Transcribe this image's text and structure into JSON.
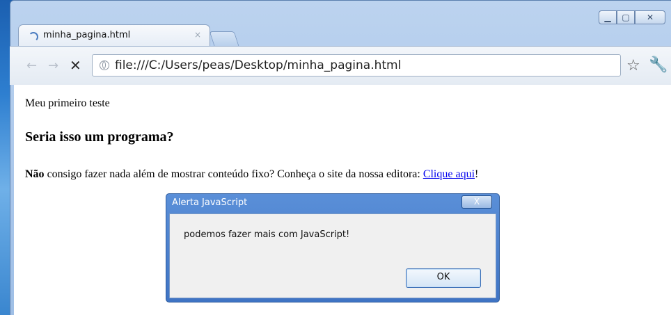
{
  "browser": {
    "tab_title": "minha_pagina.html",
    "tab_close": "×",
    "url": "file:///C:/Users/peas/Desktop/minha_pagina.html"
  },
  "window_controls": {
    "minimize": "▁",
    "maximize": "▢",
    "close": "✕"
  },
  "nav": {
    "back": "←",
    "forward": "→",
    "stop": "✕",
    "star": "☆",
    "wrench": "🔧"
  },
  "page": {
    "paragraph1": "Meu primeiro teste",
    "heading": "Seria isso um programa?",
    "paragraph2_bold": "Não",
    "paragraph2_text": " consigo fazer nada além de mostrar conteúdo fixo? Conheça o site da nossa editora: ",
    "link_text": "Clique aqui",
    "paragraph2_end": "!"
  },
  "alert": {
    "title": "Alerta JavaScript",
    "close": "X",
    "message": "podemos fazer mais com JavaScript!",
    "ok_label": "OK"
  }
}
